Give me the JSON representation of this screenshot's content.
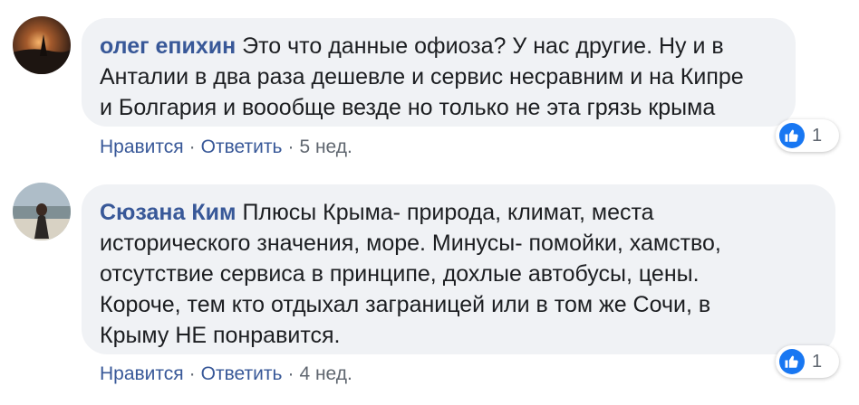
{
  "colors": {
    "link": "#385898",
    "bubble_bg": "#f0f2f5",
    "like_blue": "#1877f2",
    "meta_gray": "#606770"
  },
  "comments": [
    {
      "author": "олег епихин",
      "text_lines": [
        "Это что данные офиоза? У нас другие. Ну и в",
        "Анталии в два раза дешевле и сервис несравним и на Кипре",
        "и Болгария и воообще везде но только не эта грязь крыма"
      ],
      "like_label": "Нравится",
      "reply_label": "Ответить",
      "time": "5 нед.",
      "reactions": {
        "icon": "like-icon",
        "count": "1"
      }
    },
    {
      "author": "Сюзана Ким",
      "text_lines": [
        "Плюсы Крыма- природа, климат, места",
        "исторического значения, море. Минусы- помойки, хамство,",
        "отсутствие сервиса в принципе, дохлые автобусы, цены.",
        "Короче, тем кто отдыхал заграницей или в том же Сочи, в",
        "Крыму НЕ понравится."
      ],
      "like_label": "Нравится",
      "reply_label": "Ответить",
      "time": "4 нед.",
      "reactions": {
        "icon": "like-icon",
        "count": "1"
      }
    }
  ]
}
